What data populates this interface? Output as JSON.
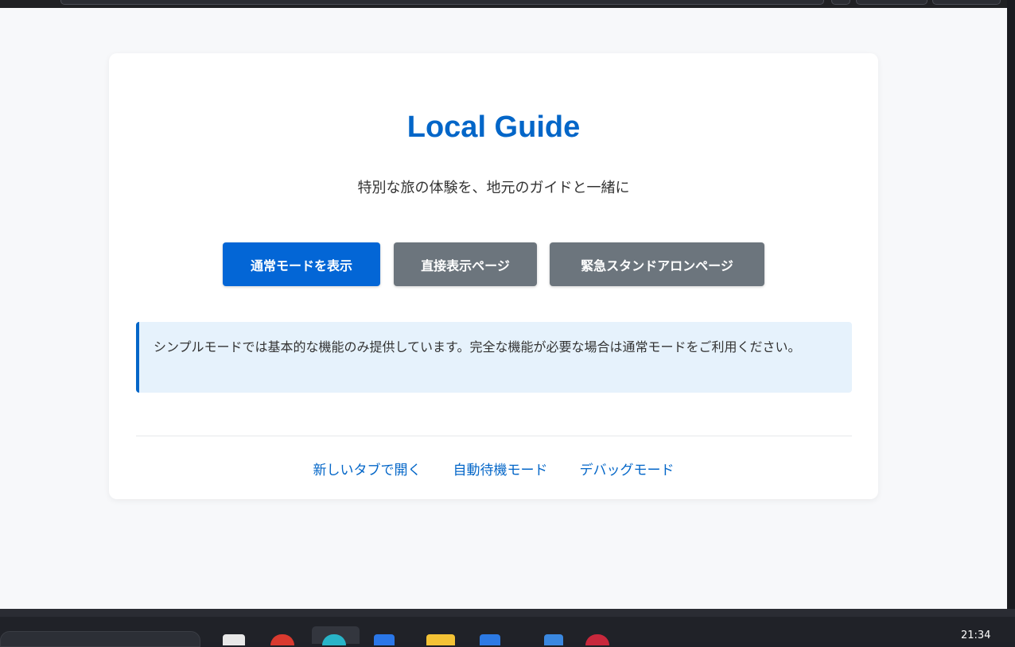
{
  "page": {
    "title": "Local Guide",
    "subtitle": "特別な旅の体験を、地元のガイドと一緒に"
  },
  "buttons": {
    "normal_mode": "通常モードを表示",
    "direct_page": "直接表示ページ",
    "emergency_page": "緊急スタンドアロンページ"
  },
  "notice": {
    "text": "シンプルモードでは基本的な機能のみ提供しています。完全な機能が必要な場合は通常モードをご利用ください。"
  },
  "links": [
    {
      "label": "新しいタブで開く"
    },
    {
      "label": "自動待機モード"
    },
    {
      "label": "デバッグモード"
    }
  ],
  "taskbar": {
    "clock": "21:34"
  },
  "colors": {
    "accent": "#0366c8",
    "secondary_button": "#6c757d",
    "notice_bg": "#e6f2fc"
  }
}
